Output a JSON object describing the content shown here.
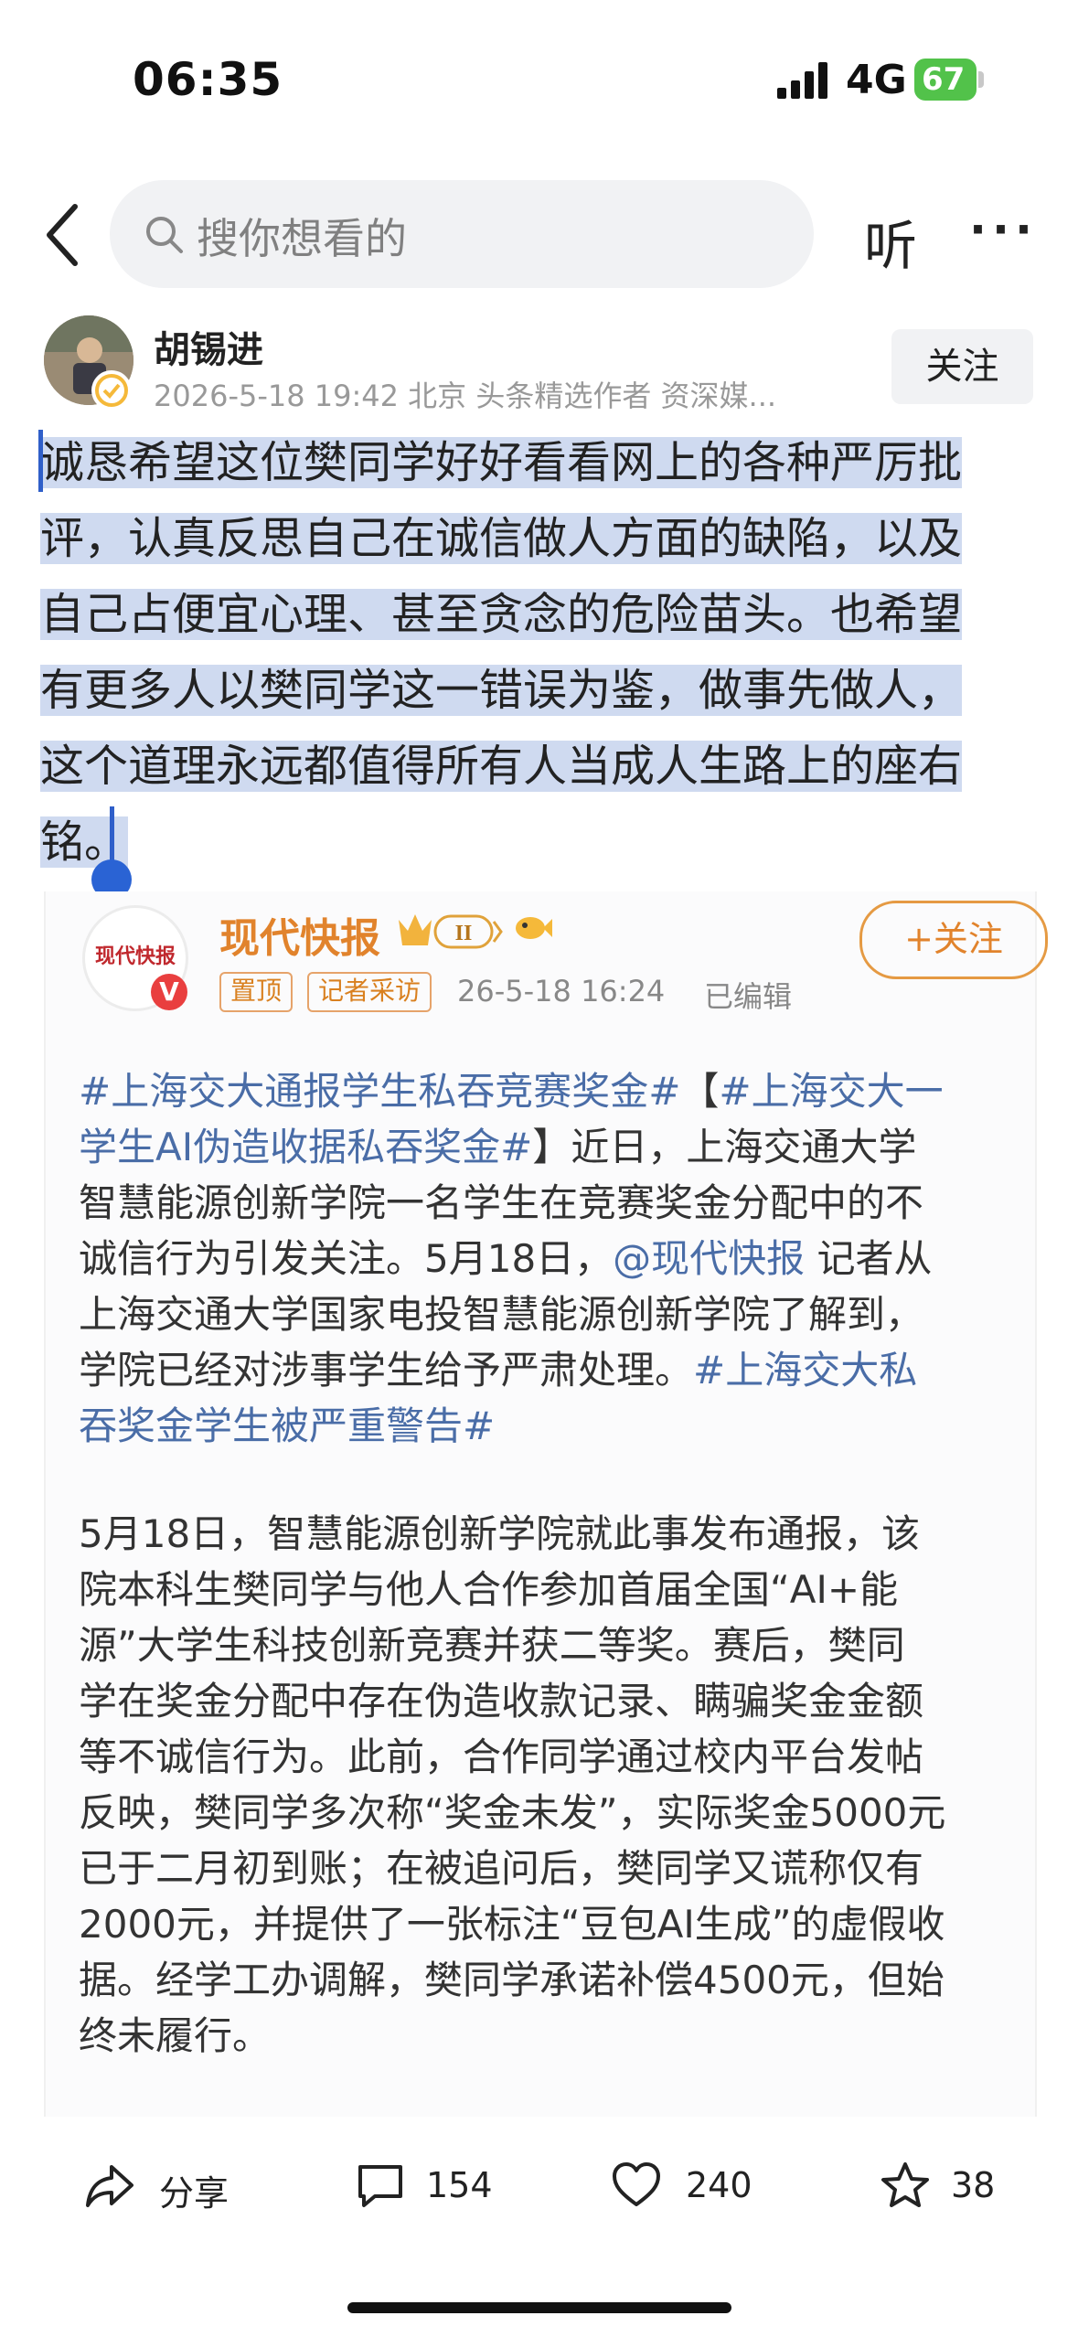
{
  "status_bar": {
    "time": "06:35",
    "network": "4G",
    "battery": "67"
  },
  "header": {
    "search_placeholder": "搜你想看的",
    "listen_label": "听",
    "more_label": "···"
  },
  "author": {
    "name": "胡锡进",
    "meta": "2026-5-18 19:42  北京  头条精选作者 资深媒...",
    "follow_label": "关注"
  },
  "post": {
    "lines": [
      "诚恳希望这位樊同学好好看看网上的各种严厉批",
      "评，认真反思自己在诚信做人方面的缺陷，以及",
      "自己占便宜心理、甚至贪念的危险苗头。也希望",
      "有更多人以樊同学这一错误为鉴，做事先做人，",
      "这个道理永远都值得所有人当成人生路上的座右",
      "铭。"
    ]
  },
  "quote": {
    "source_name": "现代快报",
    "avatar_text": "现代快报",
    "level_badge": "II",
    "pin_tag": "置顶",
    "reporter_tag": "记者采访",
    "time": "26-5-18 16:24",
    "edited": "已编辑",
    "follow_label": "+关注",
    "p1": {
      "line1_link": "#上海交大通报学生私吞竞赛奖金#",
      "line1_rest": "【",
      "line1_link2": "#上海交大一",
      "line2_link": "学生AI伪造收据私吞奖金#",
      "line2_rest": "】近日，上海交通大学",
      "line3": "智慧能源创新学院一名学生在竞赛奖金分配中的不",
      "line4_a": "诚信行为引发关注。5月18日，",
      "line4_link": "@现代快报",
      "line4_b": " 记者从",
      "line5": "上海交通大学国家电投智慧能源创新学院了解到，",
      "line6_a": "学院已经对涉事学生给予严肃处理。",
      "line6_link": "#上海交大私",
      "line7_link": "吞奖金学生被严重警告#"
    },
    "p2": [
      "5月18日，智慧能源创新学院就此事发布通报，该",
      "院本科生樊同学与他人合作参加首届全国“AI+能",
      "源”大学生科技创新竞赛并获二等奖。赛后，樊同",
      "学在奖金分配中存在伪造收款记录、瞒骗奖金金额",
      "等不诚信行为。此前，合作同学通过校内平台发帖",
      "反映，樊同学多次称“奖金未发”，实际奖金5000元",
      "已于二月初到账；在被追问后，樊同学又谎称仅有",
      "2000元，并提供了一张标注“豆包AI生成”的虚假收",
      "据。经学工办调解，樊同学承诺补偿4500元，但始",
      "终未履行。"
    ]
  },
  "bottom_bar": {
    "share_label": "分享",
    "comments": "154",
    "likes": "240",
    "favorites": "38"
  },
  "colors": {
    "accent": "#e1832c",
    "link": "#4a6da7",
    "highlight": "#cfdaf0",
    "battery": "#52c24a"
  }
}
